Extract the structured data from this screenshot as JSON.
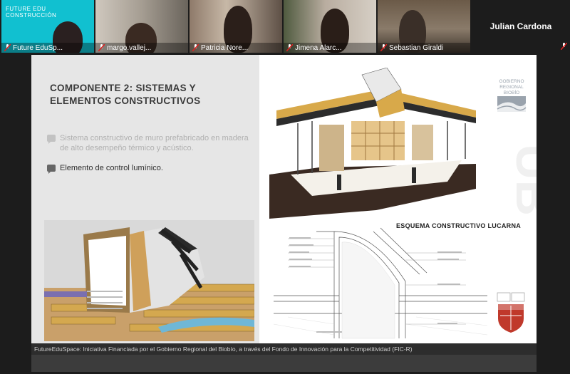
{
  "participants": [
    {
      "name": "Future EduSp...",
      "logo": "FUTURE EDU CONSTRUCCIÓN",
      "bg": "#11c0d0"
    },
    {
      "name": "margo.vallej...",
      "bg": "#8a8478"
    },
    {
      "name": "Patricia Nore...",
      "bg": "#6d5d50"
    },
    {
      "name": "Jimena Alarc...",
      "bg": "#7d6e5e"
    },
    {
      "name": "Sebastian Giraldi",
      "bg": "#4e463d"
    }
  ],
  "speaker_only": {
    "name": "Julian Cardona"
  },
  "slide": {
    "title": "COMPONENTE 2: SISTEMAS Y ELEMENTOS CONSTRUCTIVOS",
    "bullets": [
      "Sistema constructivo de muro prefabricado en madera de alto desempeño térmico y acústico.",
      "Elemento de control lumínico."
    ],
    "schema_title": "ESQUEMA CONSTRUCTIVO LUCARNA",
    "gov_logo_text": "GOBIERNO REGIONAL BIOBÍO",
    "footer": "FutureEduSpace: Iniciativa Financiada por el Gobierno Regional del Biobío, a través del Fondo de Innovación para la Competitividad (FIC-R)"
  },
  "colors": {
    "mic_muted": "#e02020",
    "slide_footer": "#2d2d2d",
    "accent_wood": "#d4a84f"
  }
}
